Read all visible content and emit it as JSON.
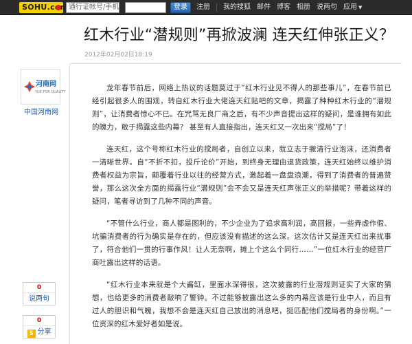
{
  "header": {
    "logo_text": "SOHU.com",
    "login_placeholder": "通行证帐号/手机",
    "login_button": "登录",
    "nav": [
      "注册",
      "我的搜狐",
      "邮件",
      "博客",
      "相册",
      "说两句",
      "应用"
    ]
  },
  "article": {
    "title": "红木行业“潜规则”再掀波澜 连天红伸张正义？",
    "date": "2012年02月02日18:19",
    "paragraphs": [
      "龙年春节前后，网络上热议的话题莫过于“红木行业见不得人的那些事儿”，在春节前已经引起很多人的围观，转自红木行业大佬连天红贴吧的文章，揭露了种种红木行业的“潜规则”，让消费者惊心不已。在咒骂无良厂商之后，有不少声音提出这样的疑问，是谁拥有如此的魄力，敢于揭露这些内幕？  甚至有人直接指出，连天红又一次出来“搅局”了！",
      "连天红，这个号称红木行业的搅局者，自创立以来，就立志于撇清行业泡沫，还消费者一清晰世界。自“不折不扣，投斤论价”开始，到终身无理由退货政策，连天红始终以维护消费者权益为宗旨，颠覆着行业以往的经营方式，激起着一盘盘浪潮，得到了消费者的普遍赞誉，那么这次全方面的揭露行业“潜规则”会不会又是连天红声张正义的举措呢？带着这样的疑问，笔者寻访到了几种不同的声音。",
      "“不管什么行业，商人都是图利的，不少企业为了追求高利润，高回报，一些弄虚作假、坑骗消费者的行为确实是存在的，但应该没有描述的这么深。这次估计又是连天红出来扰事了，符合他们一贯的行事作风！让人无奈啊，摊上个这么个同行……”一位红木行业的经营厂商吐露出这样的话语。",
      "“红木行业本来就是个大酱缸，里面水深得很，这次披露的行业潜规则证实了大家的猜想，也给更多的消费者敲响了警钟。不过能够披露出这么多的内幕应该是行业中人，而且有过人的胆识和气魄，我想不会是连天红自己放出的消息吧，挺匹配他们搅局者的身份啊。”一位资深的红木爱好者如是说。"
    ]
  },
  "sidebar": {
    "site_name": "中国河南网",
    "logo_text": "河南网",
    "logo_sub": "YUE FOR QUALITY",
    "comment": {
      "count": "0",
      "label": "说两句"
    },
    "share": {
      "count": "0",
      "label": "分享",
      "icon": "S"
    }
  },
  "colors": {
    "topbar": "#2b2b2b",
    "logo_yellow": "#f5d000",
    "link_blue": "#1f5fa8",
    "count_red": "#cc0000"
  }
}
